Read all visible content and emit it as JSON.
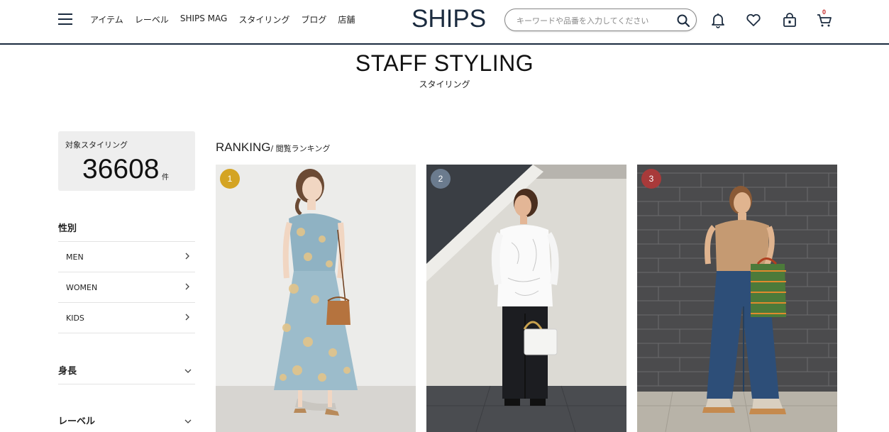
{
  "header": {
    "menu_icon": "hamburger-menu-icon",
    "nav": [
      "アイテム",
      "レーベル",
      "SHIPS MAG",
      "スタイリング",
      "ブログ",
      "店舗"
    ],
    "logo": "SHIPS",
    "search_placeholder": "キーワードや品番を入力してください",
    "icons": [
      "search-icon",
      "bell-icon",
      "heart-icon",
      "lock-bag-icon",
      "cart-icon"
    ],
    "cart_count": "0",
    "colors": {
      "navy": "#1b2b3f",
      "badge_red": "#c62828"
    }
  },
  "page": {
    "title": "STAFF STYLING",
    "subtitle": "スタイリング"
  },
  "count": {
    "label": "対象スタイリング",
    "value": "36608",
    "unit": "件"
  },
  "filters": {
    "gender_title": "性別",
    "gender_items": [
      "MEN",
      "WOMEN",
      "KIDS"
    ],
    "height_title": "身長",
    "label_title": "レーベル"
  },
  "ranking": {
    "title": "RANKING",
    "subtitle": "/ 閲覧ランキング",
    "cards": [
      {
        "rank": "1",
        "badge_color": "#d4a423"
      },
      {
        "rank": "2",
        "badge_color": "#6b7b8e"
      },
      {
        "rank": "3",
        "badge_color": "#a83a3a"
      }
    ]
  }
}
